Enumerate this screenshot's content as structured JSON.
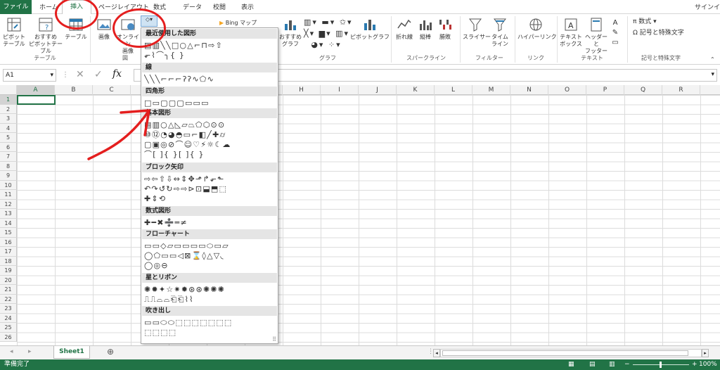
{
  "tabs": {
    "file": "ファイル",
    "home": "ホーム",
    "insert": "挿入",
    "page_layout": "ページレイアウト",
    "formulas": "数式",
    "data": "データ",
    "review": "校閲",
    "view": "表示",
    "sign_in": "サインイン"
  },
  "ribbon": {
    "pivot": "ピボット\nテーブル",
    "recommended_pivot": "おすすめ\nピボットテーブル",
    "table": "テーブル",
    "group_table": "テーブル",
    "images": "画像",
    "online_images": "オンライン\n画像",
    "group_figures": "図",
    "store": "ストア",
    "bing_maps": "Bing マップ",
    "recommended_charts": "おすすめ\nグラフ",
    "pivot_chart": "ピボットグラフ",
    "group_charts": "グラフ",
    "sparkline_line": "折れ線",
    "sparkline_column": "縦棒",
    "sparkline_winloss": "勝敗",
    "group_sparklines": "スパークライン",
    "slicer": "スライサー",
    "timeline": "タイム\nライン",
    "group_filter": "フィルター",
    "hyperlink": "ハイパーリンク",
    "group_link": "リンク",
    "textbox": "テキスト\nボックス",
    "header_footer": "ヘッダーと\nフッター",
    "group_text": "テキスト",
    "equation": "数式",
    "symbol": "記号と特殊文字",
    "group_symbols": "記号と特殊文字"
  },
  "namebox": "A1",
  "fx_label": "fx",
  "columns": [
    "A",
    "B",
    "C",
    "D",
    "E",
    "F",
    "G",
    "H",
    "I",
    "J",
    "K",
    "L",
    "M",
    "N",
    "O",
    "P",
    "Q",
    "R"
  ],
  "rows": [
    "1",
    "2",
    "3",
    "4",
    "5",
    "6",
    "7",
    "8",
    "9",
    "10",
    "11",
    "12",
    "13",
    "14",
    "15",
    "16",
    "17",
    "18",
    "19",
    "20",
    "21",
    "22",
    "23",
    "24",
    "25",
    "26"
  ],
  "shapes_gallery": {
    "recent": "最近使用した図形",
    "lines": "線",
    "rectangles": "四角形",
    "basic": "基本図形",
    "block_arrows": "ブロック矢印",
    "equation_shapes": "数式図形",
    "flowchart": "フローチャート",
    "stars": "星とリボン",
    "callouts": "吹き出し",
    "rows": {
      "r1": "▤▥╲╲□○△⌐⊓⇨⇧",
      "r2": "⬐⌇⌒╮{ }",
      "l1": "╲╲╲⌐⌐⌐ʔʔ∿⬠∿",
      "q1": "□▭▢▢▢▭▭▭",
      "b1": "▤▥○△◺▱⏢⬠⬡⊙⊙",
      "b2": "⑩⑫◔◕◓▭⌐◧╱✚⌭",
      "b3": "▢▣◎⊘⌒☺♡⚡☼☾☁",
      "b4": "⌒[ ]{ }[ ]{ }",
      "a1": "⇨⇦⇧⇩⇔⇕✥⬏↱⬐⬑",
      "a2": "↶↷↺↻⇨⇨⊳⊡⬓⬒⬚",
      "a3": "✚⇕⟲",
      "e1": "✚━✖➗═≠",
      "f1": "▭▭◇▱▭▭▭▭⬭▭▱",
      "f2": "◯⬠▭▭◁⊠⌛◊△▽◟",
      "f3": "◯◎⊖",
      "s1": "✺✹✦☆✷✹⊛⊛✺✺✺",
      "s2": "⎍⎍⌓⌓⎗⎗⌇⌇",
      "c1": "▭▭⬭⬭⬚⬚⬚⬚⬚⬚⬚",
      "c2": "⬚⬚⬚⬚"
    }
  },
  "sheet_tab": "Sheet1",
  "add_sheet": "⊕",
  "status": "準備完了",
  "zoom": "100%",
  "colors": {
    "excel_green": "#217346",
    "annotation_red": "#e41e1e"
  }
}
